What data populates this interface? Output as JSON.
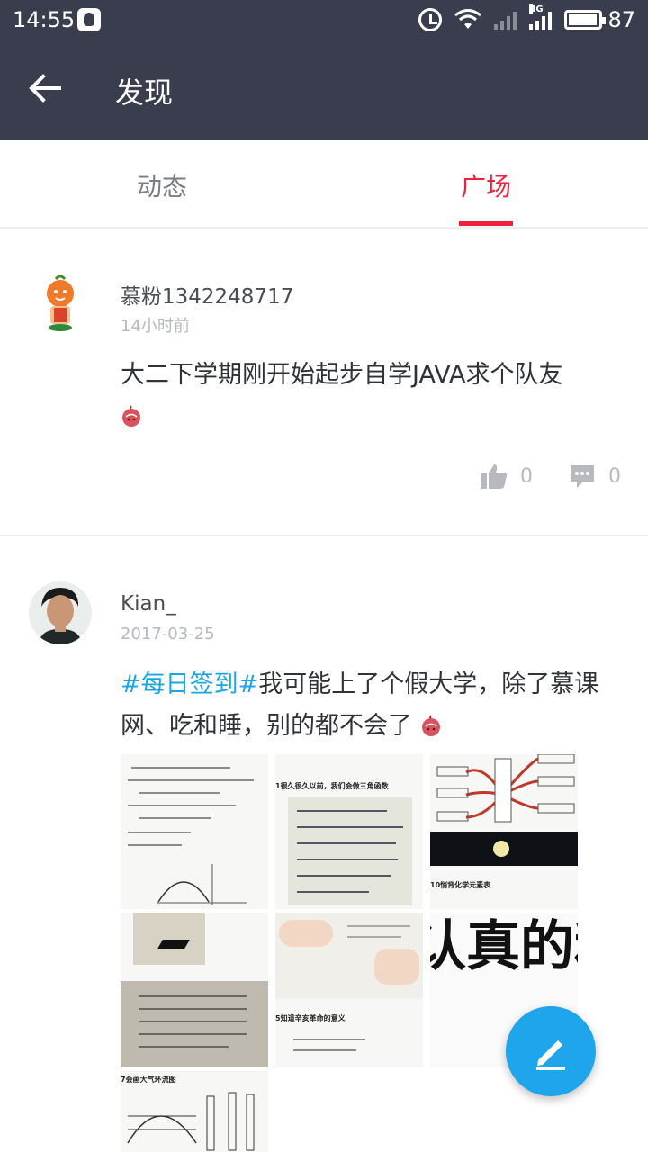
{
  "status_bar": {
    "time": "14:55",
    "network": "4G",
    "battery_pct": "87"
  },
  "header": {
    "title": "发现",
    "back_icon": "arrow-left-icon"
  },
  "tabs": [
    {
      "label": "动态",
      "active": false
    },
    {
      "label": "广场",
      "active": true
    }
  ],
  "accent_color": "#f01f3e",
  "hashtag_color": "#1ca6e6",
  "posts": [
    {
      "username": "慕粉1342248717",
      "time": "14小时前",
      "content": "大二下学期刚开始起步自学JAVA求个队友",
      "likes": "0",
      "comments": "0"
    },
    {
      "username": "Kian_",
      "time": "2017-03-25",
      "hashtag": "#每日签到#",
      "content": "我可能上了个假大学，除了慕课网、吃和睡，别的都不会了",
      "images": {
        "img2_caption": "1很久很久以前，我们会做三角函数",
        "img3_caption": "10悄背化学元素表",
        "img5_caption": "5知道辛亥革命的意义",
        "img6_text": "认真的和路边贴",
        "img7_caption": "7会画大气环流图"
      }
    }
  ],
  "fab_icon": "pencil-icon"
}
